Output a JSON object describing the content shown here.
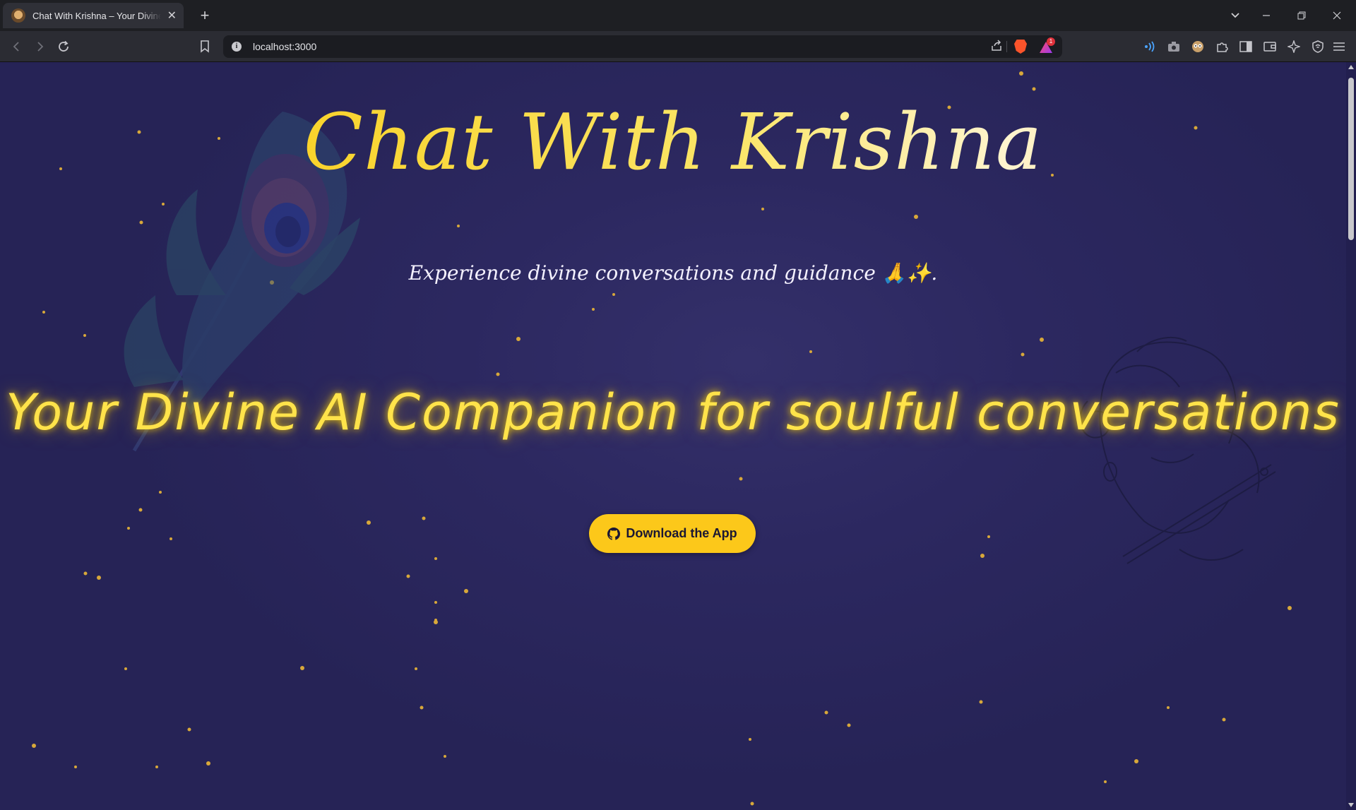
{
  "browser": {
    "tab_title": "Chat With Krishna – Your Divine AI Companion",
    "new_tab_label": "+",
    "url": "localhost:3000",
    "rewards_badge": "1"
  },
  "hero": {
    "title": "Chat With Krishna",
    "tagline": "Experience divine conversations and guidance 🙏✨.",
    "headline": "Your Divine AI Companion for soulful conversations",
    "download_button": "Download the App"
  },
  "colors": {
    "accent": "#fcc81a",
    "background": "#2c2860",
    "headline": "#ffe34a"
  },
  "icons": {
    "button_icon": "github-icon",
    "decor_left": "peacock-feather-icon",
    "decor_right": "krishna-flute-illustration"
  }
}
